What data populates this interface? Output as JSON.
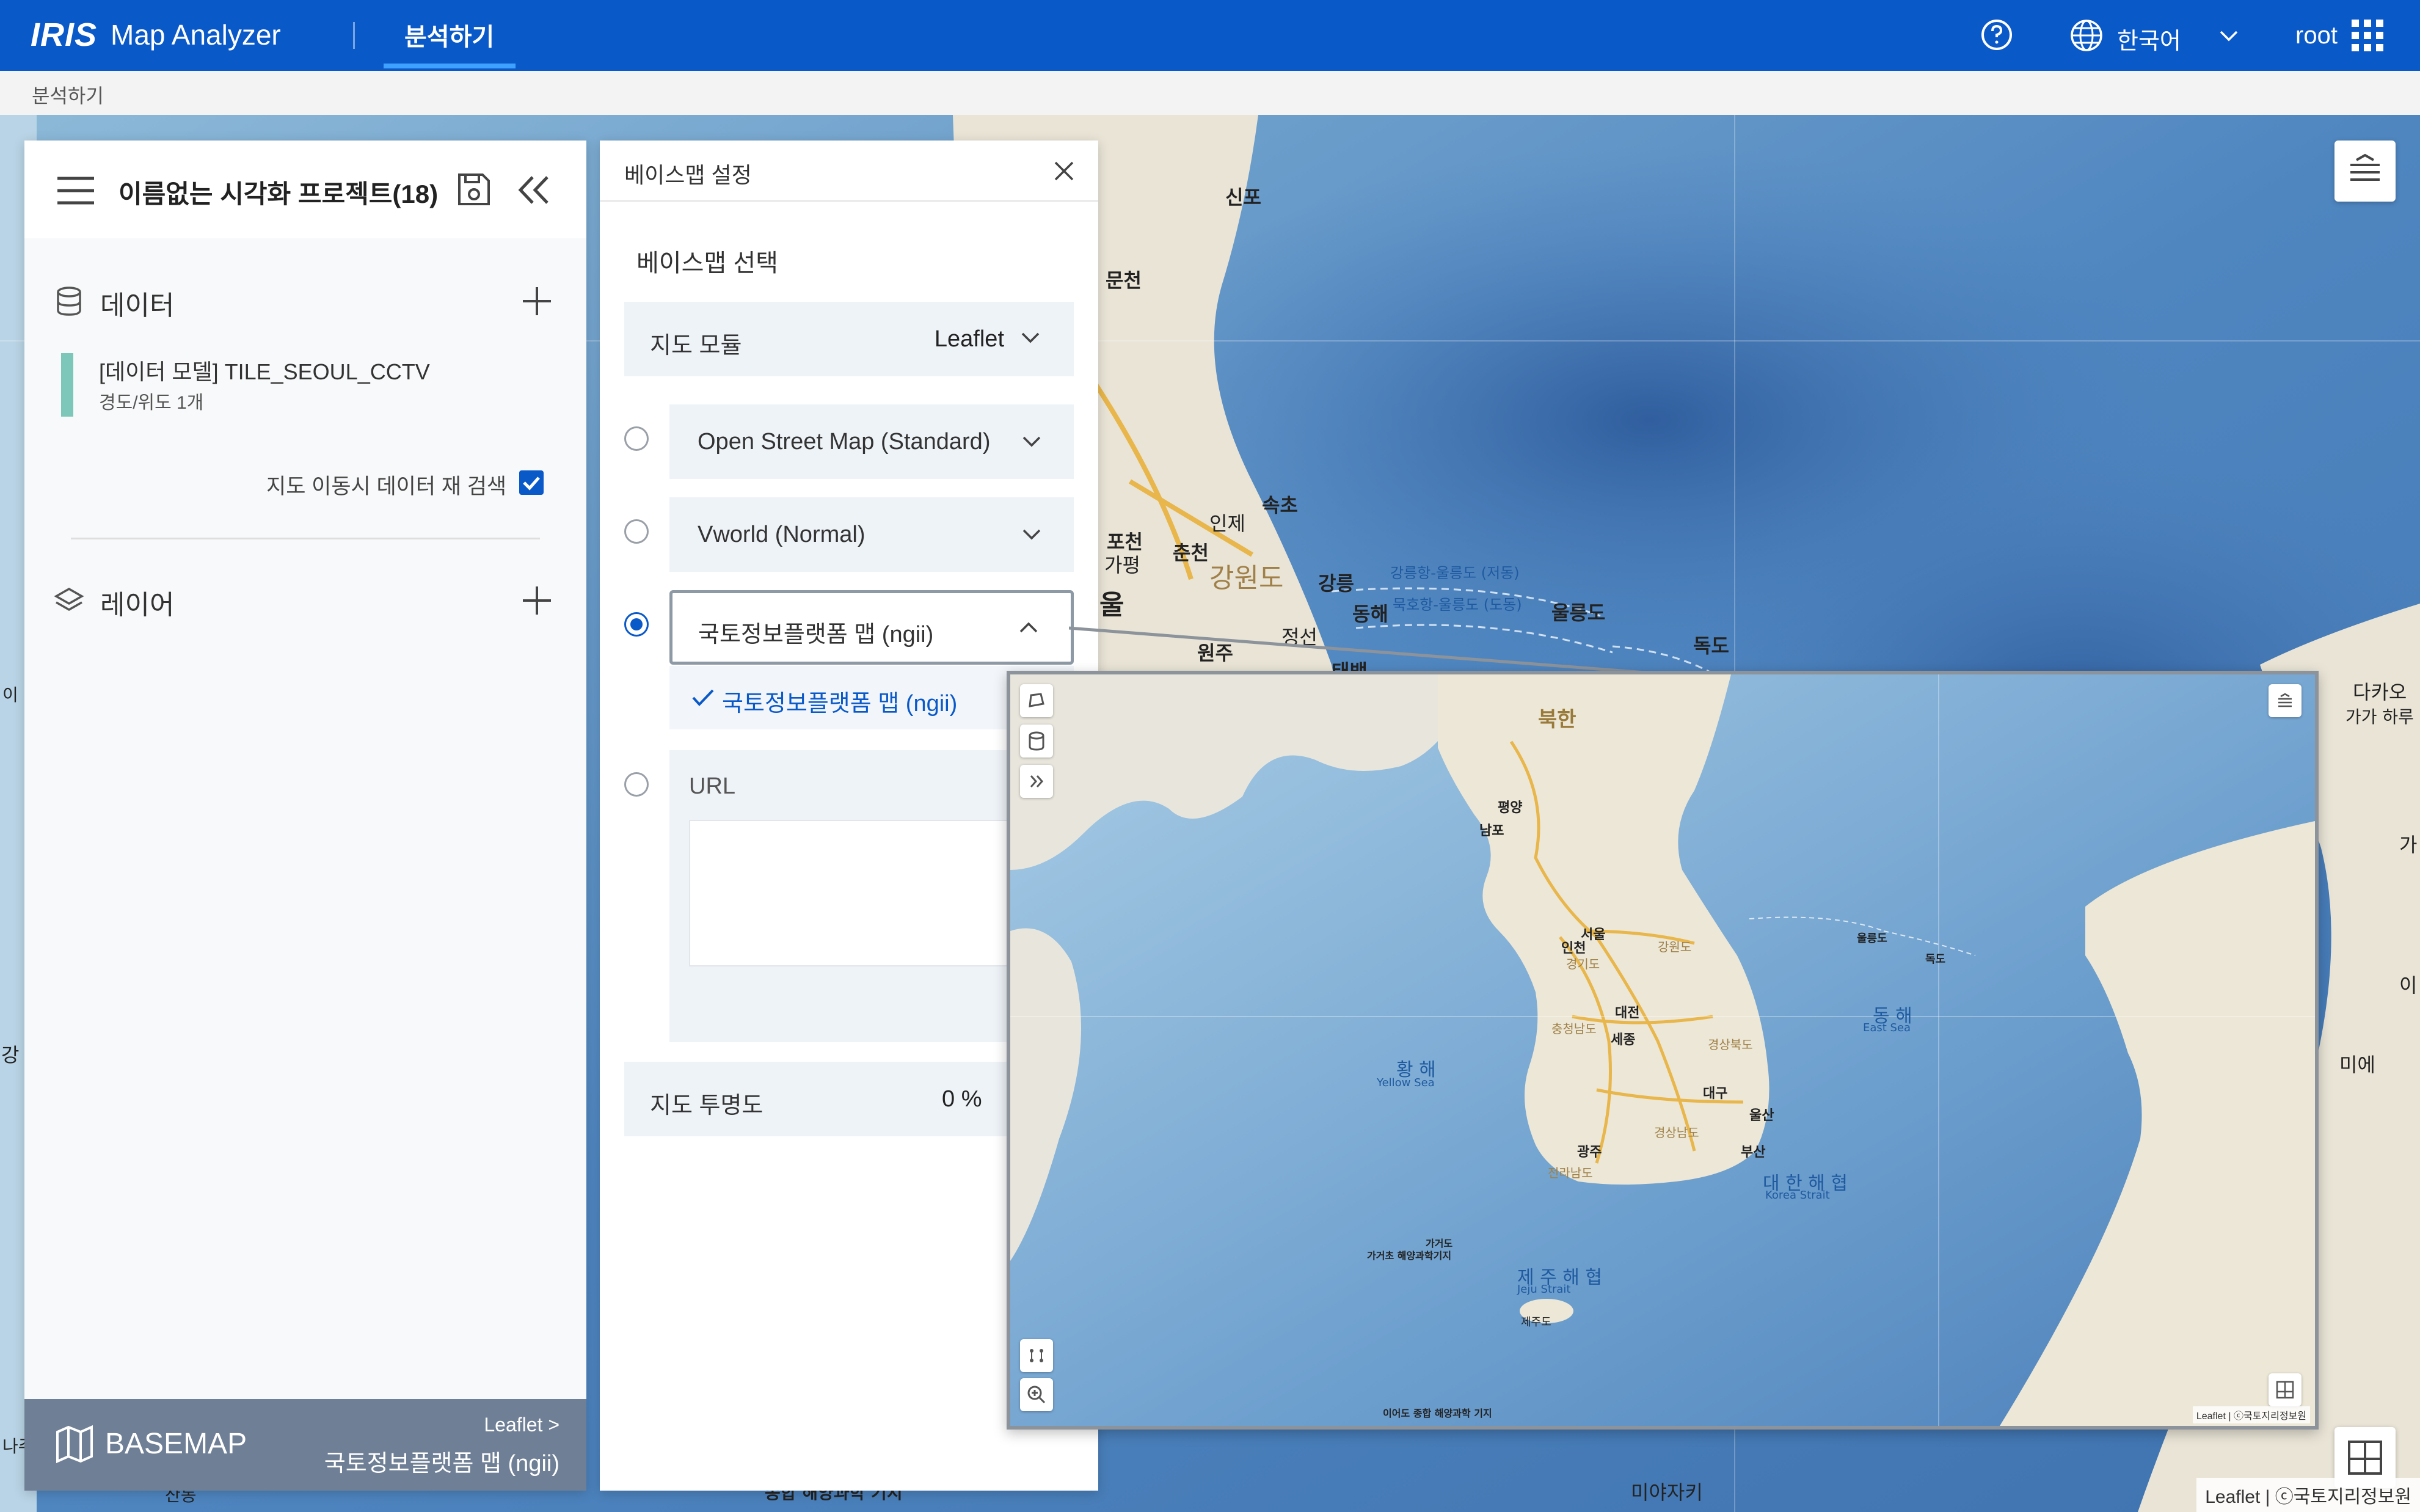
{
  "header": {
    "logo": "IRIS",
    "app_name": "Map Analyzer",
    "active_tab": "분석하기",
    "language": "한국어",
    "user": "root"
  },
  "breadcrumb": "분석하기",
  "left_panel": {
    "project_title": "이름없는 시각화 프로젝트(18)",
    "data_section": {
      "title": "데이터",
      "item_name": "[데이터 모델] TILE_SEOUL_CCTV",
      "item_sub": "경도/위도 1개",
      "research_label": "지도 이동시 데이터 재 검색",
      "research_checked": true
    },
    "layer_section": {
      "title": "레이어"
    },
    "basemap": {
      "label": "BASEMAP",
      "engine": "Leaflet >",
      "current": "국토정보플랫폼 맵 (ngii)"
    }
  },
  "settings_panel": {
    "title": "베이스맵 설정",
    "section_title": "베이스맵 선택",
    "module_label": "지도 모듈",
    "module_value": "Leaflet",
    "options": [
      {
        "label": "Open Street Map (Standard)",
        "selected": false
      },
      {
        "label": "Vworld (Normal)",
        "selected": false
      },
      {
        "label": "국토정보플랫폼 맵 (ngii)",
        "selected": true
      }
    ],
    "selected_sub_option": "국토정보플랫폼 맵 (ngii)",
    "url_label": "URL",
    "opacity_label": "지도 투명도",
    "opacity_value": "0 %"
  },
  "map": {
    "labels": {
      "sinpo": "신포",
      "muncheon": "문천",
      "pocheon": "포천",
      "chuncheon": "춘천",
      "inje": "인제",
      "sokcho": "속초",
      "gapyeong": "가평",
      "gangwondo": "강원도",
      "gangneung": "강릉",
      "donghae": "동해",
      "jeongseon": "정선",
      "wonju": "원주",
      "taebaek": "태백",
      "ulleungdo": "울릉도",
      "dokdo": "독도",
      "seoul_partial": "울",
      "dakao": "다카오",
      "kagaharu": "가가 하루",
      "mie": "미에",
      "miyazaki": "미야자키",
      "gangneung_ferry": "강릉항-울릉도 (저동)",
      "mukho_ferry": "묵호항-울릉도 (도동)",
      "left_edge_1": "이",
      "left_edge_2": "강",
      "left_edge_3": "나주",
      "left_edge_4": "산동",
      "right_edge_1": "가",
      "right_edge_2": "이",
      "bottom_1": "기지",
      "bottom_2": "종합 해양과학 기지"
    },
    "preview_labels": {
      "bukhan": "북한",
      "pyongyang": "평양",
      "nampo": "남포",
      "seoul": "서울",
      "incheon": "인천",
      "daejeon": "대전",
      "daegu": "대구",
      "busan": "부산",
      "ulsan": "울산",
      "gwangju": "광주",
      "sejong": "세종",
      "yellow_sea": "황 해",
      "yellow_sea_en": "Yellow Sea",
      "east_sea": "동 해",
      "east_sea_en": "East Sea",
      "korea_strait": "대 한 해 협",
      "korea_strait_en": "Korea Strait",
      "jeju_strait": "제 주 해 협",
      "jeju_strait_en": "Jeju Strait",
      "jeju": "제주도",
      "dokdo": "독도",
      "ulleungdo": "울릉도",
      "gyeonggi": "경기도",
      "chungnam": "충청남도",
      "jeonnam": "전라남도",
      "gyeongbuk": "경상북도",
      "gyeongnam": "경상남도",
      "gangwon": "강원도",
      "research_base": "가거초 해양과학기지",
      "gageodo": "가거도",
      "ieodo": "이어도 종합 해양과학 기지"
    },
    "attribution": "Leaflet | ⓒ국토지리정보원",
    "preview_attribution": "Leaflet | ⓒ국토지리정보원"
  },
  "colors": {
    "primary": "#0a59c9",
    "tab_underline": "#3fa1ff",
    "data_bar": "#7cc7b9",
    "basemap_bar": "#6f7f96"
  }
}
